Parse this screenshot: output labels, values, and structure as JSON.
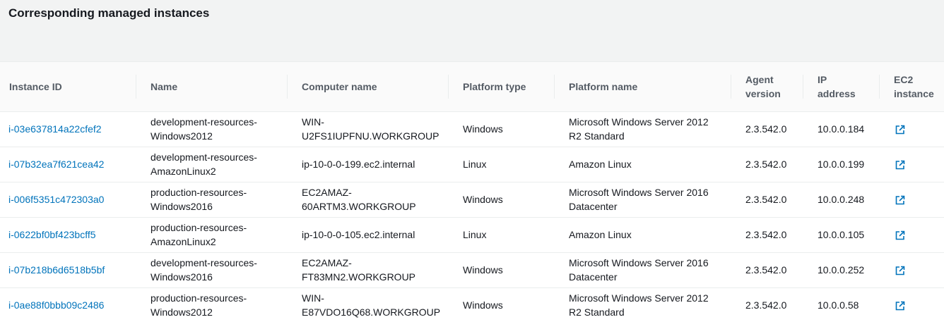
{
  "panel": {
    "title": "Corresponding managed instances"
  },
  "columns": {
    "instance_id": "Instance ID",
    "name": "Name",
    "computer_name": "Computer name",
    "platform_type": "Platform type",
    "platform_name": "Platform name",
    "agent_version_line1": "Agent",
    "agent_version_line2": "version",
    "ip_address_line1": "IP",
    "ip_address_line2": "address",
    "ec2_instance_line1": "EC2",
    "ec2_instance_line2": "instance"
  },
  "rows": [
    {
      "instance_id": "i-03e637814a22cfef2",
      "name_line1": "development-resources-",
      "name_line2": "Windows2012",
      "computer_line1": "WIN-",
      "computer_line2": "U2FS1IUPFNU.WORKGROUP",
      "platform_type": "Windows",
      "platform_line1": "Microsoft Windows Server 2012",
      "platform_line2": "R2 Standard",
      "agent_version": "2.3.542.0",
      "ip_address": "10.0.0.184",
      "ec2_icon": "external-link-icon"
    },
    {
      "instance_id": "i-07b32ea7f621cea42",
      "name_line1": "development-resources-",
      "name_line2": "AmazonLinux2",
      "computer_line1": "ip-10-0-0-199.ec2.internal",
      "computer_line2": "",
      "platform_type": "Linux",
      "platform_line1": "Amazon Linux",
      "platform_line2": "",
      "agent_version": "2.3.542.0",
      "ip_address": "10.0.0.199",
      "ec2_icon": "external-link-icon"
    },
    {
      "instance_id": "i-006f5351c472303a0",
      "name_line1": "production-resources-",
      "name_line2": "Windows2016",
      "computer_line1": "EC2AMAZ-",
      "computer_line2": "60ARTM3.WORKGROUP",
      "platform_type": "Windows",
      "platform_line1": "Microsoft Windows Server 2016",
      "platform_line2": "Datacenter",
      "agent_version": "2.3.542.0",
      "ip_address": "10.0.0.248",
      "ec2_icon": "external-link-icon"
    },
    {
      "instance_id": "i-0622bf0bf423bcff5",
      "name_line1": "production-resources-",
      "name_line2": "AmazonLinux2",
      "computer_line1": "ip-10-0-0-105.ec2.internal",
      "computer_line2": "",
      "platform_type": "Linux",
      "platform_line1": "Amazon Linux",
      "platform_line2": "",
      "agent_version": "2.3.542.0",
      "ip_address": "10.0.0.105",
      "ec2_icon": "external-link-icon"
    },
    {
      "instance_id": "i-07b218b6d6518b5bf",
      "name_line1": "development-resources-",
      "name_line2": "Windows2016",
      "computer_line1": "EC2AMAZ-",
      "computer_line2": "FT83MN2.WORKGROUP",
      "platform_type": "Windows",
      "platform_line1": "Microsoft Windows Server 2016",
      "platform_line2": "Datacenter",
      "agent_version": "2.3.542.0",
      "ip_address": "10.0.0.252",
      "ec2_icon": "external-link-icon"
    },
    {
      "instance_id": "i-0ae88f0bbb09c2486",
      "name_line1": "production-resources-",
      "name_line2": "Windows2012",
      "computer_line1": "WIN-",
      "computer_line2": "E87VDO16Q68.WORKGROUP",
      "platform_type": "Windows",
      "platform_line1": "Microsoft Windows Server 2012",
      "platform_line2": "R2 Standard",
      "agent_version": "2.3.542.0",
      "ip_address": "10.0.0.58",
      "ec2_icon": "external-link-icon"
    }
  ],
  "colors": {
    "link": "#0073bb",
    "header_bg": "#f2f3f3",
    "header_text": "#545b64",
    "body_text": "#16191f",
    "border": "#eaeded"
  }
}
